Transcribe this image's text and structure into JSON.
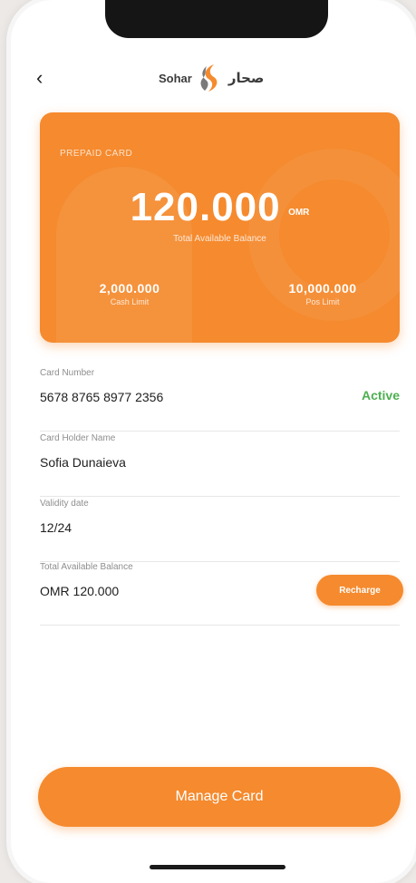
{
  "header": {
    "back_icon": "chevron-left-icon",
    "logo_text_en": "Sohar",
    "logo_text_ar": "صحار"
  },
  "card": {
    "type_label": "PREPAID CARD",
    "balance": "120.000",
    "currency": "OMR",
    "balance_label": "Total Available Balance",
    "cash_limit_value": "2,000.000",
    "cash_limit_label": "Cash Limit",
    "pos_limit_value": "10,000.000",
    "pos_limit_label": "Pos Limit",
    "color": "#f58a2e"
  },
  "fields": {
    "card_number_label": "Card Number",
    "card_number_value": "5678 8765 8977 2356",
    "status": "Active",
    "status_color": "#4caf50",
    "holder_label": "Card Holder Name",
    "holder_value": "Sofia Dunaieva",
    "validity_label": "Validity date",
    "validity_value": "12/24",
    "balance_label": "Total Available Balance",
    "balance_value": "OMR 120.000",
    "recharge_label": "Recharge"
  },
  "actions": {
    "manage_label": "Manage Card"
  }
}
